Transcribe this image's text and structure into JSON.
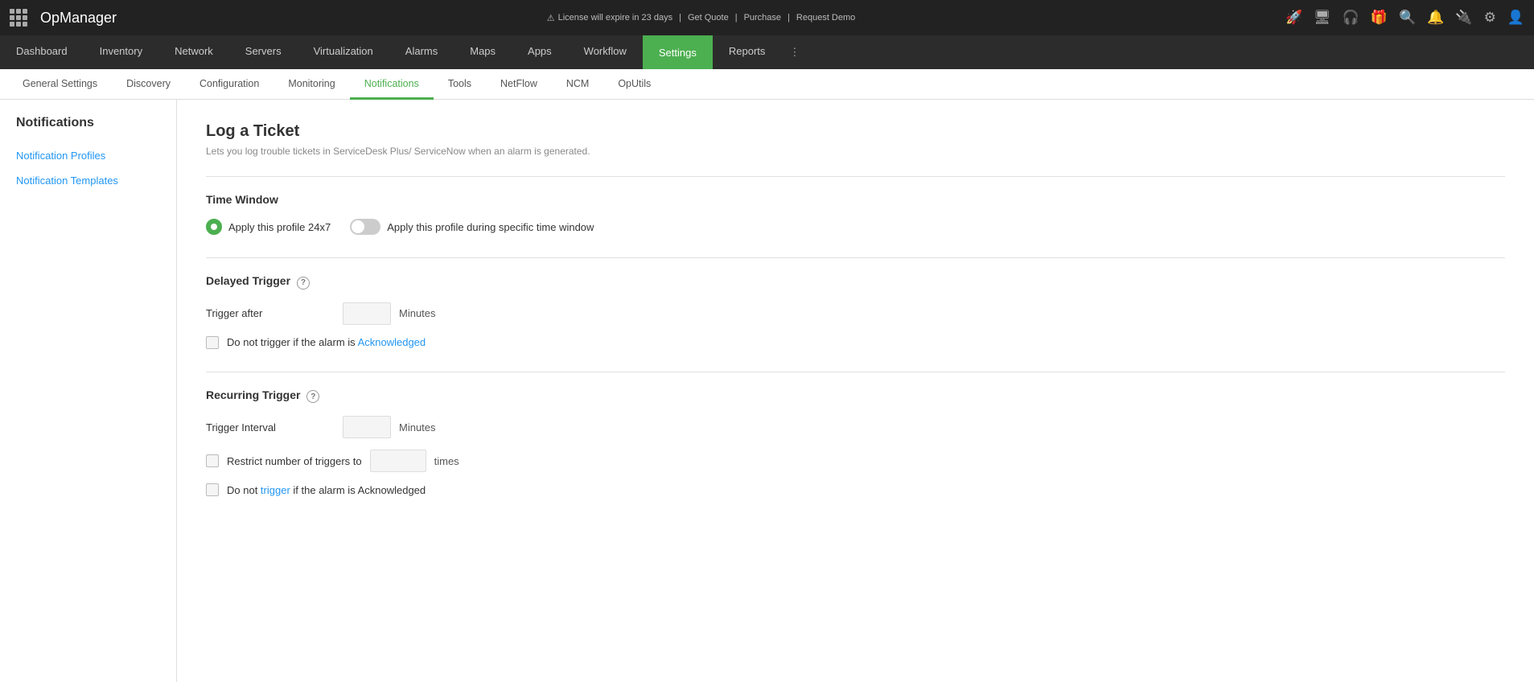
{
  "app": {
    "name": "OpManager"
  },
  "topbar": {
    "license_text": "License will expire in 23 days",
    "get_quote": "Get Quote",
    "purchase": "Purchase",
    "request_demo": "Request Demo"
  },
  "main_nav": {
    "items": [
      {
        "label": "Dashboard",
        "active": false
      },
      {
        "label": "Inventory",
        "active": false
      },
      {
        "label": "Network",
        "active": false
      },
      {
        "label": "Servers",
        "active": false
      },
      {
        "label": "Virtualization",
        "active": false
      },
      {
        "label": "Alarms",
        "active": false
      },
      {
        "label": "Maps",
        "active": false
      },
      {
        "label": "Apps",
        "active": false
      },
      {
        "label": "Workflow",
        "active": false
      },
      {
        "label": "Settings",
        "active": true
      },
      {
        "label": "Reports",
        "active": false
      }
    ]
  },
  "sub_nav": {
    "items": [
      {
        "label": "General Settings",
        "active": false
      },
      {
        "label": "Discovery",
        "active": false
      },
      {
        "label": "Configuration",
        "active": false
      },
      {
        "label": "Monitoring",
        "active": false
      },
      {
        "label": "Notifications",
        "active": true
      },
      {
        "label": "Tools",
        "active": false
      },
      {
        "label": "NetFlow",
        "active": false
      },
      {
        "label": "NCM",
        "active": false
      },
      {
        "label": "OpUtils",
        "active": false
      }
    ]
  },
  "sidebar": {
    "title": "Notifications",
    "links": [
      {
        "label": "Notification Profiles"
      },
      {
        "label": "Notification Templates"
      }
    ]
  },
  "page": {
    "title": "Log a Ticket",
    "subtitle": "Lets you log trouble tickets in ServiceDesk Plus/ ServiceNow when an alarm is generated."
  },
  "time_window": {
    "section_title": "Time Window",
    "option1_label": "Apply this profile 24x7",
    "option2_label": "Apply this profile during specific time window"
  },
  "delayed_trigger": {
    "section_title": "Delayed Trigger",
    "trigger_after_label": "Trigger after",
    "trigger_after_value": "",
    "unit": "Minutes",
    "checkbox_label": "Do not trigger if the alarm is Acknowledged",
    "checkbox_highlight": "Acknowledged"
  },
  "recurring_trigger": {
    "section_title": "Recurring Trigger",
    "trigger_interval_label": "Trigger Interval",
    "trigger_interval_value": "",
    "unit": "Minutes",
    "restrict_label_prefix": "Restrict number of triggers to",
    "restrict_value": "",
    "restrict_unit": "times",
    "checkbox_label_prefix": "Do not ",
    "checkbox_label_highlight": "trigger",
    "checkbox_label_suffix": " if the alarm is Acknowledged"
  }
}
